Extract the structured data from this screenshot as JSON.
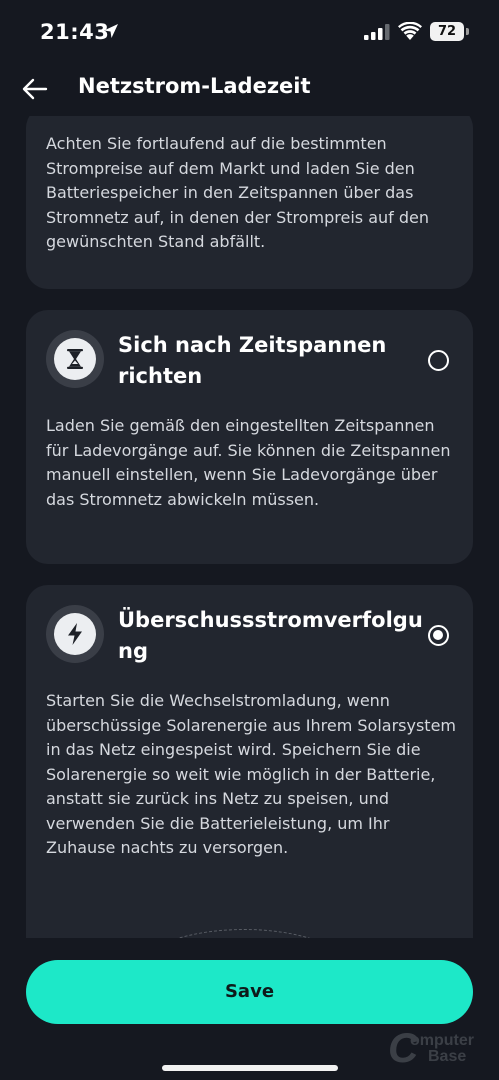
{
  "status_bar": {
    "time": "21:43",
    "battery_level": "72"
  },
  "header": {
    "title": "Netzstrom-Ladezeit"
  },
  "cards": [
    {
      "description": "Achten Sie fortlaufend auf die bestimmten Strompreise auf dem Markt und laden Sie den Batteriespeicher in den Zeitspannen über das Stromnetz auf, in denen der Strompreis auf den gewünschten Stand abfällt."
    },
    {
      "title": "Sich nach Zeitspannen richten",
      "icon": "hourglass-icon",
      "selected": false,
      "description": "Laden Sie gemäß den eingestellten Zeitspannen für Ladevorgänge auf. Sie können die Zeitspannen manuell einstellen, wenn Sie Ladevorgänge über das Stromnetz abwickeln müssen."
    },
    {
      "title": "Überschussstromverfolgu ng",
      "icon": "lightning-icon",
      "selected": true,
      "description": "Starten Sie die Wechselstromladung, wenn überschüssige Solarenergie aus Ihrem Solarsystem in das Netz eingespeist wird. Speichern Sie die Solarenergie so weit wie möglich in der Batterie, anstatt sie zurück ins Netz zu speisen, und verwenden Sie die Batterieleistung, um Ihr Zuhause nachts zu versorgen."
    }
  ],
  "footer": {
    "save_label": "Save"
  },
  "watermark": {
    "letter": "C",
    "line1": "omputer",
    "line2": "Base"
  },
  "colors": {
    "accent": "#1de8c8",
    "background": "#151820",
    "card": "#22262f"
  }
}
